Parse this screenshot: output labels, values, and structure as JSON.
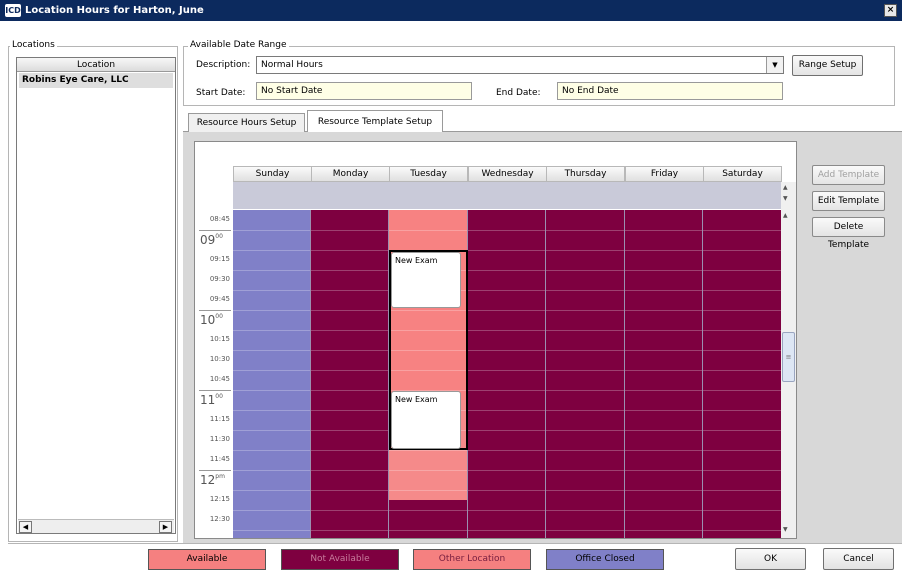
{
  "window": {
    "title": "Location Hours for Harton, June",
    "icon_text": "ICD",
    "close_glyph": "×"
  },
  "locations": {
    "group_label": "Locations",
    "column_header": "Location",
    "items": [
      "Robins Eye Care, LLC"
    ]
  },
  "date_range": {
    "group_label": "Available Date Range",
    "description_label": "Description:",
    "description_value": "Normal Hours",
    "range_setup_label": "Range Setup",
    "start_label": "Start Date:",
    "start_value": "No Start Date",
    "end_label": "End Date:",
    "end_value": "No End Date"
  },
  "tabs": [
    {
      "label": "Resource Hours Setup",
      "active": false
    },
    {
      "label": "Resource Template Setup",
      "active": true
    }
  ],
  "schedule": {
    "days": [
      "Sunday",
      "Monday",
      "Tuesday",
      "Wednesday",
      "Thursday",
      "Friday",
      "Saturday"
    ],
    "time_labels": [
      "08:45",
      "09:15",
      "09:30",
      "09:45",
      "10:15",
      "10:30",
      "10:45",
      "11:15",
      "11:30",
      "11:45",
      "12:15",
      "12:30"
    ],
    "hour_labels": [
      {
        "h": "09",
        "s": "00"
      },
      {
        "h": "10",
        "s": "00"
      },
      {
        "h": "11",
        "s": "00"
      },
      {
        "h": "12",
        "s": "pm"
      }
    ],
    "appointments": [
      "New Exam",
      "New Exam"
    ],
    "colors": {
      "office_closed": "#8080c8",
      "not_available": "#7e0040",
      "available": "#f78282",
      "other_location": "#f58a8a",
      "allday": "#c9cad9"
    }
  },
  "template_buttons": {
    "add": "Add Template",
    "edit": "Edit Template",
    "delete": "Delete Template"
  },
  "legend": [
    {
      "label": "Available",
      "color": "#f58080",
      "text_color": "#000000"
    },
    {
      "label": "Not Available",
      "color": "#7e0040",
      "text_color": "#c77a9b"
    },
    {
      "label": "Other Location",
      "color": "#f58080",
      "text_color": "#7a2040"
    },
    {
      "label": "Office Closed",
      "color": "#8080c8",
      "text_color": "#000000"
    }
  ],
  "footer": {
    "ok_label": "OK",
    "cancel_label": "Cancel"
  }
}
